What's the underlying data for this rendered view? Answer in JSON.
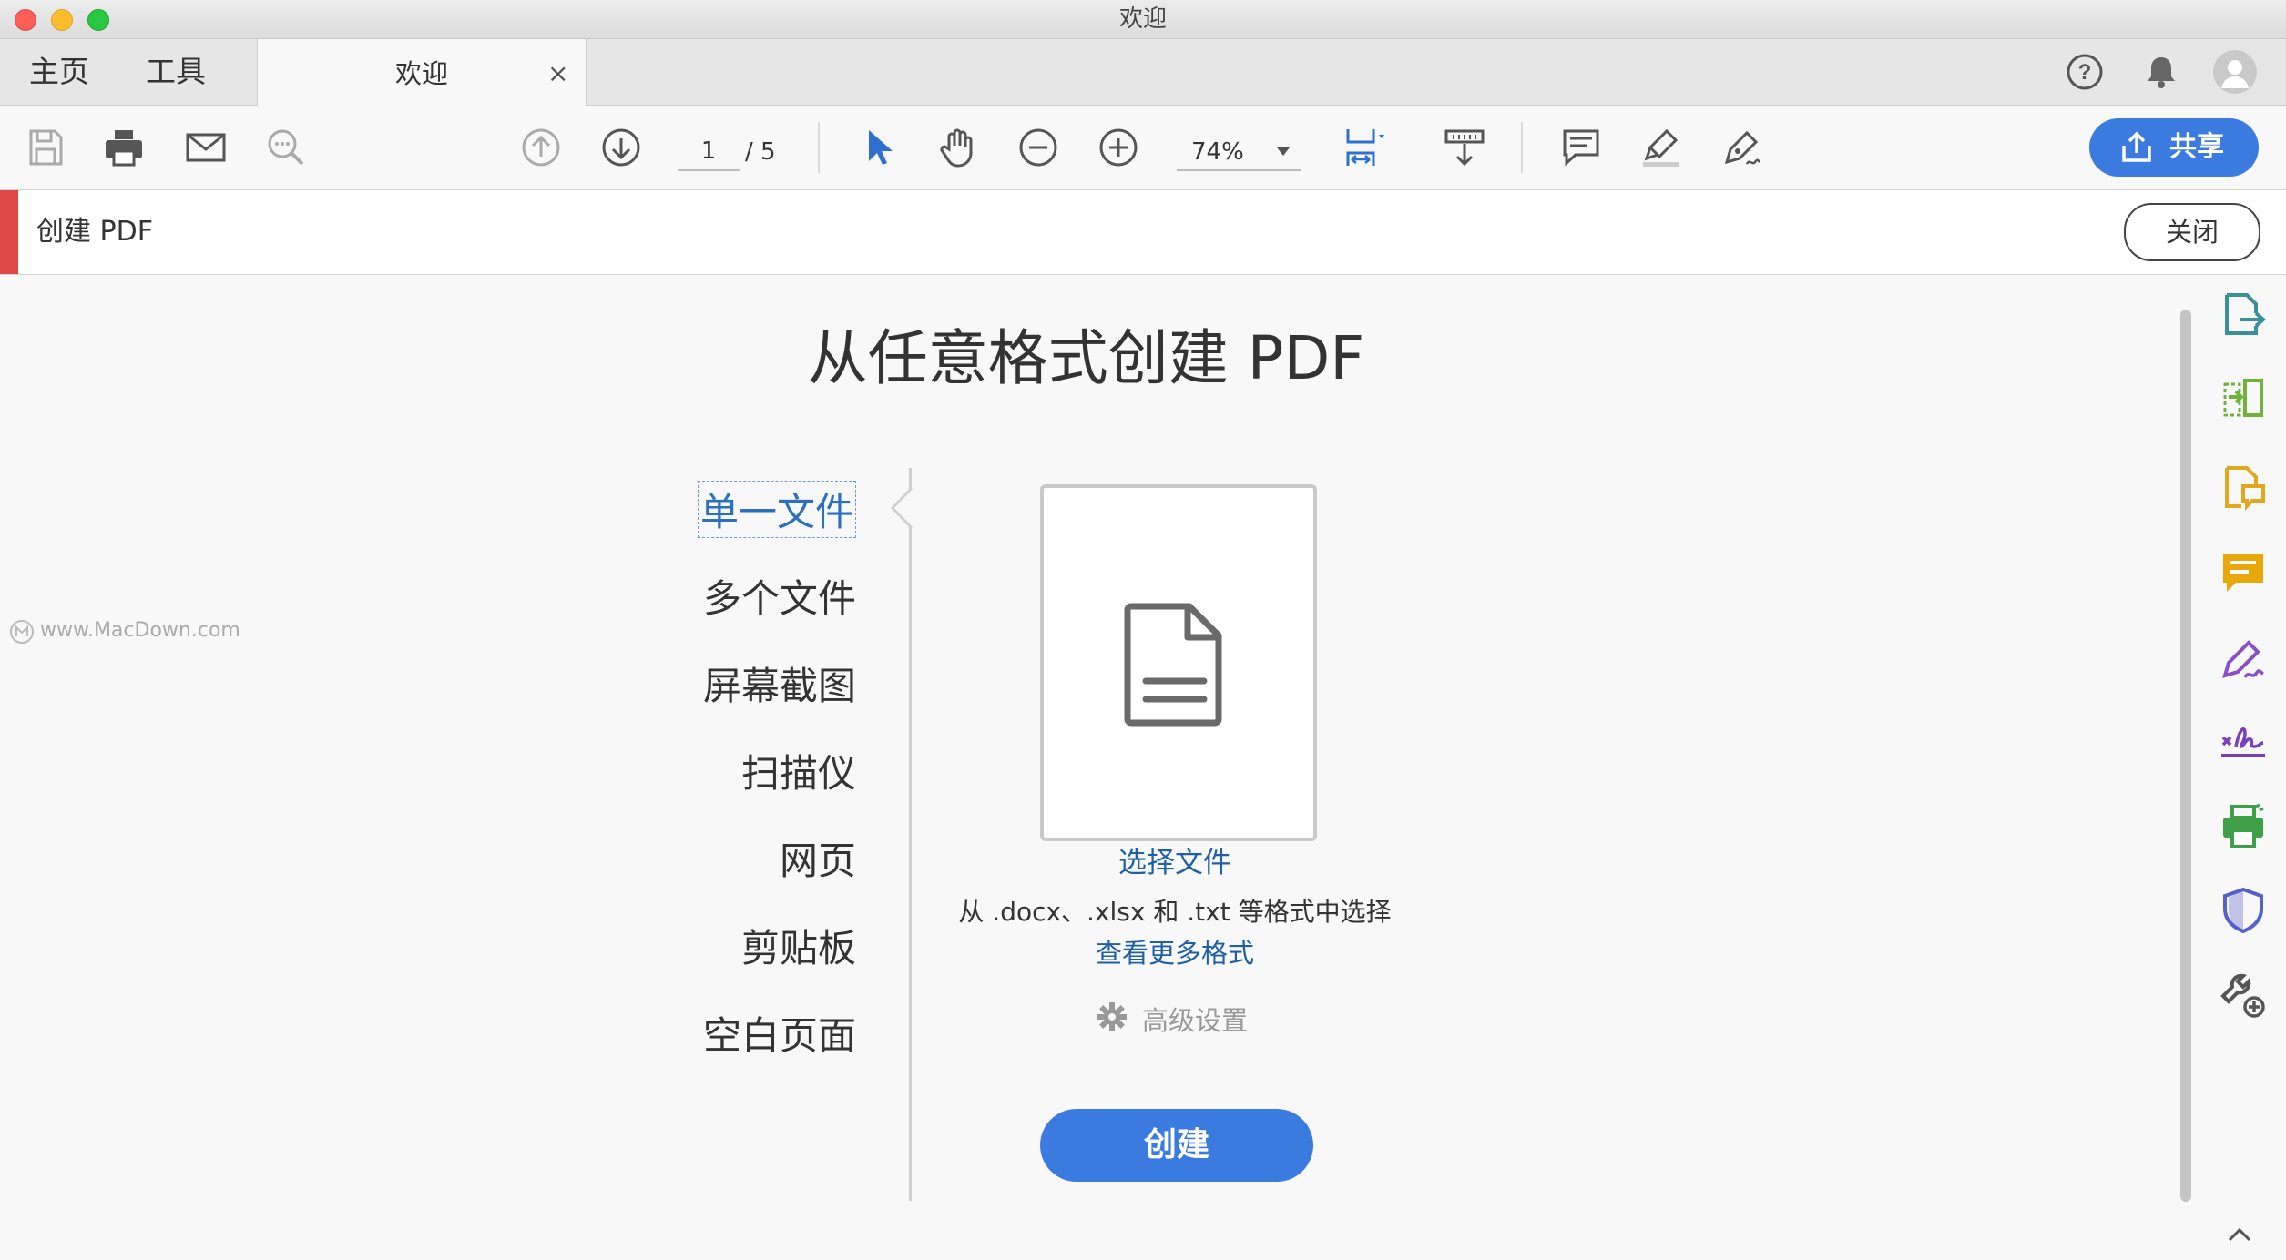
{
  "window": {
    "title": "欢迎"
  },
  "nav": {
    "home": "主页",
    "tools": "工具",
    "active_tab": "欢迎",
    "close_tab": "×"
  },
  "toolbar": {
    "page_current": "1",
    "page_total": "/ 5",
    "zoom": "74%",
    "share_label": "共享"
  },
  "create_bar": {
    "title": "创建 PDF",
    "close_label": "关闭"
  },
  "main": {
    "title": "从任意格式创建 PDF",
    "menu": [
      {
        "label": "单一文件",
        "selected": true
      },
      {
        "label": "多个文件"
      },
      {
        "label": "屏幕截图"
      },
      {
        "label": "扫描仪"
      },
      {
        "label": "网页"
      },
      {
        "label": "剪贴板"
      },
      {
        "label": "空白页面"
      }
    ],
    "select_file": "选择文件",
    "formats_text": "从 .docx、.xlsx 和 .txt 等格式中选择",
    "more_formats": "查看更多格式",
    "advanced_settings": "高级设置",
    "create_button": "创建"
  },
  "watermark": "www.MacDown.com",
  "colors": {
    "accent": "#3b7be0",
    "link": "#1f5fa8",
    "create_red": "#e04848"
  }
}
